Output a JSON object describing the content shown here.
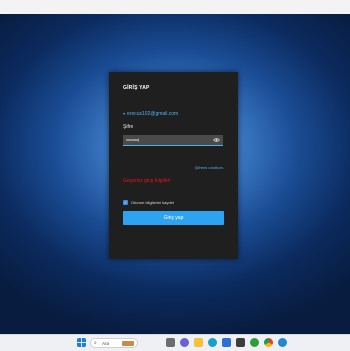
{
  "dialog": {
    "title": "GİRİŞ YAP",
    "account_email": "erecus102@gmail.com",
    "password_label": "Şifre",
    "password_value": "•••••••••••|",
    "forgot_link": "Şifremi unuttum.",
    "error_text": "Geçersiz giriş bilgileri",
    "remember_label": "Oturum bilgilerini kaydet",
    "remember_checked": true,
    "login_button": "Giriş yap"
  },
  "taskbar": {
    "search_placeholder": "Ara",
    "icons": [
      "windows-start-icon",
      "task-view-icon",
      "chat-icon",
      "file-explorer-icon",
      "edge-icon",
      "store-icon",
      "calculator-icon",
      "xbox-icon",
      "chrome-icon",
      "app-icon"
    ]
  },
  "colors": {
    "accent": "#2ea3f2",
    "error": "#e81123",
    "dialog_bg": "#1f1f1f"
  }
}
